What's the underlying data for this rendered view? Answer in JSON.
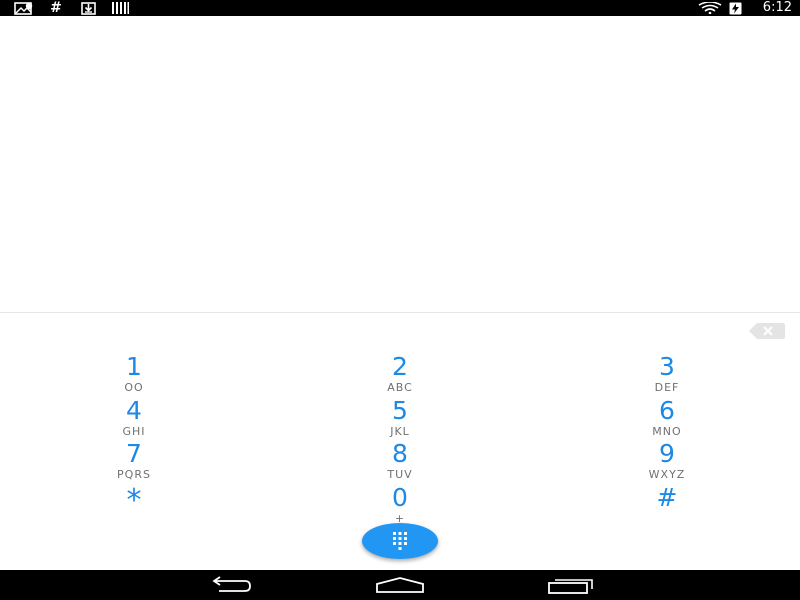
{
  "status_bar": {
    "time": "6:12",
    "left_icons": [
      "picture-notification-icon",
      "hash-notification-icon",
      "download-notification-icon",
      "barcode-notification-icon"
    ],
    "right_icons": [
      "wifi-icon",
      "battery-charging-icon"
    ],
    "hash_glyph": "#"
  },
  "dialer": {
    "digits_display": "",
    "keys": [
      {
        "digit": "1",
        "letters": "OO"
      },
      {
        "digit": "2",
        "letters": "ABC"
      },
      {
        "digit": "3",
        "letters": "DEF"
      },
      {
        "digit": "4",
        "letters": "GHI"
      },
      {
        "digit": "5",
        "letters": "JKL"
      },
      {
        "digit": "6",
        "letters": "MNO"
      },
      {
        "digit": "7",
        "letters": "PQRS"
      },
      {
        "digit": "8",
        "letters": "TUV"
      },
      {
        "digit": "9",
        "letters": "WXYZ"
      },
      {
        "digit": "*",
        "letters": ""
      },
      {
        "digit": "0",
        "letters": "+"
      },
      {
        "digit": "#",
        "letters": ""
      }
    ],
    "delete_icon": "backspace-icon",
    "fab_icon": "dialpad-icon"
  },
  "nav_bar": {
    "buttons": [
      "back-icon",
      "home-icon",
      "recents-icon"
    ]
  },
  "colors": {
    "accent": "#1e88e5",
    "fab": "#2196f3",
    "letters": "#707070",
    "bars": "#000000"
  }
}
